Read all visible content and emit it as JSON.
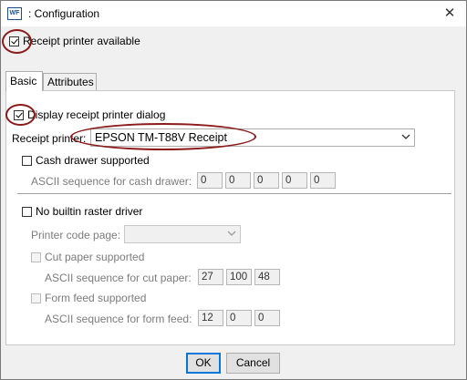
{
  "window": {
    "icon_text": "WF",
    "title": ": Configuration",
    "close_glyph": "✕"
  },
  "receipt_printer_available": {
    "label": "Receipt printer available",
    "checked": true
  },
  "tabs": [
    {
      "label": "Basic",
      "active": true
    },
    {
      "label": "Attributes",
      "active": false
    }
  ],
  "basic": {
    "display_dialog": {
      "label": "Display receipt printer dialog",
      "checked": true
    },
    "receipt_printer": {
      "label": "Receipt printer:",
      "value": "EPSON TM-T88V Receipt"
    },
    "cash_drawer": {
      "label": "Cash drawer supported",
      "checked": false,
      "ascii_label": "ASCII sequence for cash drawer:",
      "values": [
        "0",
        "0",
        "0",
        "0",
        "0"
      ]
    },
    "no_raster": {
      "label": "No builtin raster driver",
      "checked": false
    },
    "code_page": {
      "label": "Printer code page:",
      "value": ""
    },
    "cut_paper": {
      "label": "Cut paper supported",
      "checked": false,
      "ascii_label": "ASCII sequence for cut paper:",
      "values": [
        "27",
        "100",
        "48"
      ]
    },
    "form_feed": {
      "label": "Form feed supported",
      "checked": false,
      "ascii_label": "ASCII sequence for form feed:",
      "values": [
        "12",
        "0",
        "0"
      ]
    }
  },
  "buttons": {
    "ok": "OK",
    "cancel": "Cancel"
  },
  "colors": {
    "annotation_ring": "#8b1a1a",
    "default_button_border": "#0078d7"
  }
}
